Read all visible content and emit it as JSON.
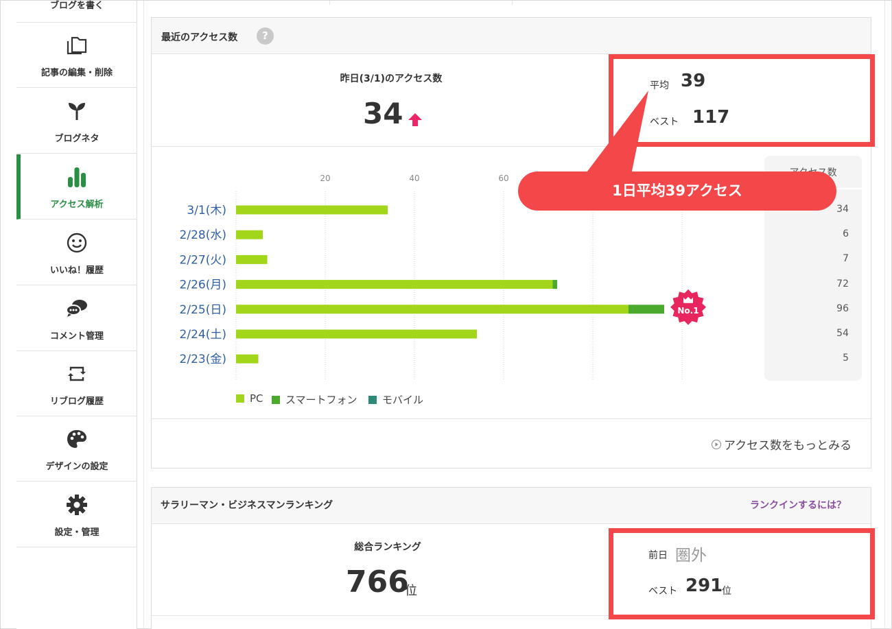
{
  "sidebar": {
    "top_label": "ブログを書く",
    "items": [
      {
        "label": "記事の編集・削除",
        "icon": "folder-icon"
      },
      {
        "label": "ブログネタ",
        "icon": "sprout-icon"
      },
      {
        "label": "アクセス解析",
        "icon": "bar-chart-icon",
        "active": true
      },
      {
        "label": "いいね！履歴",
        "icon": "smile-icon"
      },
      {
        "label": "コメント管理",
        "icon": "comment-icon"
      },
      {
        "label": "リブログ履歴",
        "icon": "reblog-icon"
      },
      {
        "label": "デザインの設定",
        "icon": "palette-icon"
      },
      {
        "label": "設定・管理",
        "icon": "gear-icon"
      }
    ]
  },
  "access": {
    "title": "最近のアクセス数",
    "help": "?",
    "yesterday_label": "昨日(3/1)のアクセス数",
    "yesterday_value": "34",
    "avg_label": "平均",
    "avg_value": "39",
    "best_label": "ベスト",
    "best_value": "117",
    "table_header": "アクセス数",
    "badge": "No.1",
    "more_link": "アクセス数をもっとみる"
  },
  "callout": "1日平均39アクセス",
  "colors": {
    "pc": "#a2d61b",
    "smartphone": "#4ba92e",
    "mobile": "#2b8a78",
    "highlight": "#f4474a",
    "active": "#2a8e45",
    "badge": "#e8265e"
  },
  "chart_data": {
    "type": "bar",
    "orientation": "horizontal",
    "stacked": true,
    "categories": [
      "3/1(木)",
      "2/28(水)",
      "2/27(火)",
      "2/26(月)",
      "2/25(日)",
      "2/24(土)",
      "2/23(金)"
    ],
    "series": [
      {
        "name": "PC",
        "values": [
          34,
          6,
          7,
          71,
          88,
          54,
          5
        ]
      },
      {
        "name": "スマートフォン",
        "values": [
          0,
          0,
          0,
          1,
          8,
          0,
          0
        ]
      },
      {
        "name": "モバイル",
        "values": [
          0,
          0,
          0,
          0,
          0,
          0,
          0
        ]
      }
    ],
    "totals": [
      34,
      6,
      7,
      72,
      96,
      54,
      5
    ],
    "xticks": [
      20,
      40,
      60
    ],
    "xlim": [
      0,
      120
    ],
    "grid": true,
    "legend": "bottom-left"
  },
  "ranking": {
    "title": "サラリーマン・ビジネスマンランキング",
    "link": "ランクインするには？",
    "total_label": "総合ランキング",
    "total_value": "766",
    "unit": "位",
    "prev_label": "前日",
    "prev_value": "圏外",
    "best_label": "ベスト",
    "best_value": "291",
    "best_unit": "位"
  }
}
